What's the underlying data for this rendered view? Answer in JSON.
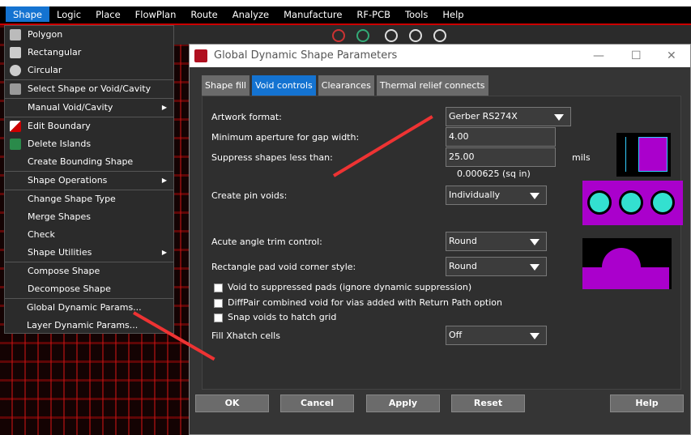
{
  "menubar": {
    "items": [
      "Shape",
      "Logic",
      "Place",
      "FlowPlan",
      "Route",
      "Analyze",
      "Manufacture",
      "RF-PCB",
      "Tools",
      "Help"
    ]
  },
  "shape_menu": {
    "items": [
      {
        "label": "Polygon",
        "icon": "polygon-icon"
      },
      {
        "label": "Rectangular",
        "icon": "rectangle-icon"
      },
      {
        "label": "Circular",
        "icon": "circle-icon"
      },
      {
        "label": "Select Shape or Void/Cavity",
        "icon": "select-icon"
      },
      {
        "label": "Manual Void/Cavity",
        "submenu": true
      },
      {
        "label": "Edit Boundary",
        "icon": "edit-boundary-icon"
      },
      {
        "label": "Delete Islands",
        "icon": "delete-islands-icon"
      },
      {
        "label": "Create Bounding Shape"
      },
      {
        "label": "Shape Operations",
        "submenu": true
      },
      {
        "label": "Change Shape Type"
      },
      {
        "label": "Merge Shapes"
      },
      {
        "label": "Check"
      },
      {
        "label": "Shape Utilities",
        "submenu": true
      },
      {
        "label": "Compose Shape"
      },
      {
        "label": "Decompose Shape"
      },
      {
        "label": "Global Dynamic Params..."
      },
      {
        "label": "Layer Dynamic Params..."
      }
    ]
  },
  "dialog": {
    "title": "Global Dynamic Shape Parameters",
    "tabs": [
      "Shape fill",
      "Void controls",
      "Clearances",
      "Thermal relief connects"
    ],
    "artwork_format_label": "Artwork format:",
    "artwork_format": "Gerber RS274X",
    "min_aperture_label": "Minimum aperture for gap width:",
    "min_aperture": "4.00",
    "suppress_label": "Suppress shapes less than:",
    "suppress": "25.00",
    "suppress_unit": "mils",
    "suppress_area": "0.000625 (sq in)",
    "pin_voids_label": "Create pin voids:",
    "pin_voids": "Individually",
    "acute_label": "Acute angle trim control:",
    "acute": "Round",
    "rect_pad_label": "Rectangle pad void corner style:",
    "rect_pad": "Round",
    "checkboxes": [
      "Void to suppressed pads (ignore dynamic suppression)",
      "DiffPair combined void for vias added with Return Path option",
      "Snap voids to hatch grid"
    ],
    "xhatch_label": "Fill Xhatch cells",
    "xhatch": "Off",
    "buttons": {
      "ok": "OK",
      "cancel": "Cancel",
      "apply": "Apply",
      "reset": "Reset",
      "help": "Help"
    }
  },
  "colors": {
    "accent": "#1473d1",
    "preview": "#aa00cc",
    "pad": "#33e0d0",
    "annotation_arrow": "#ee3333"
  }
}
